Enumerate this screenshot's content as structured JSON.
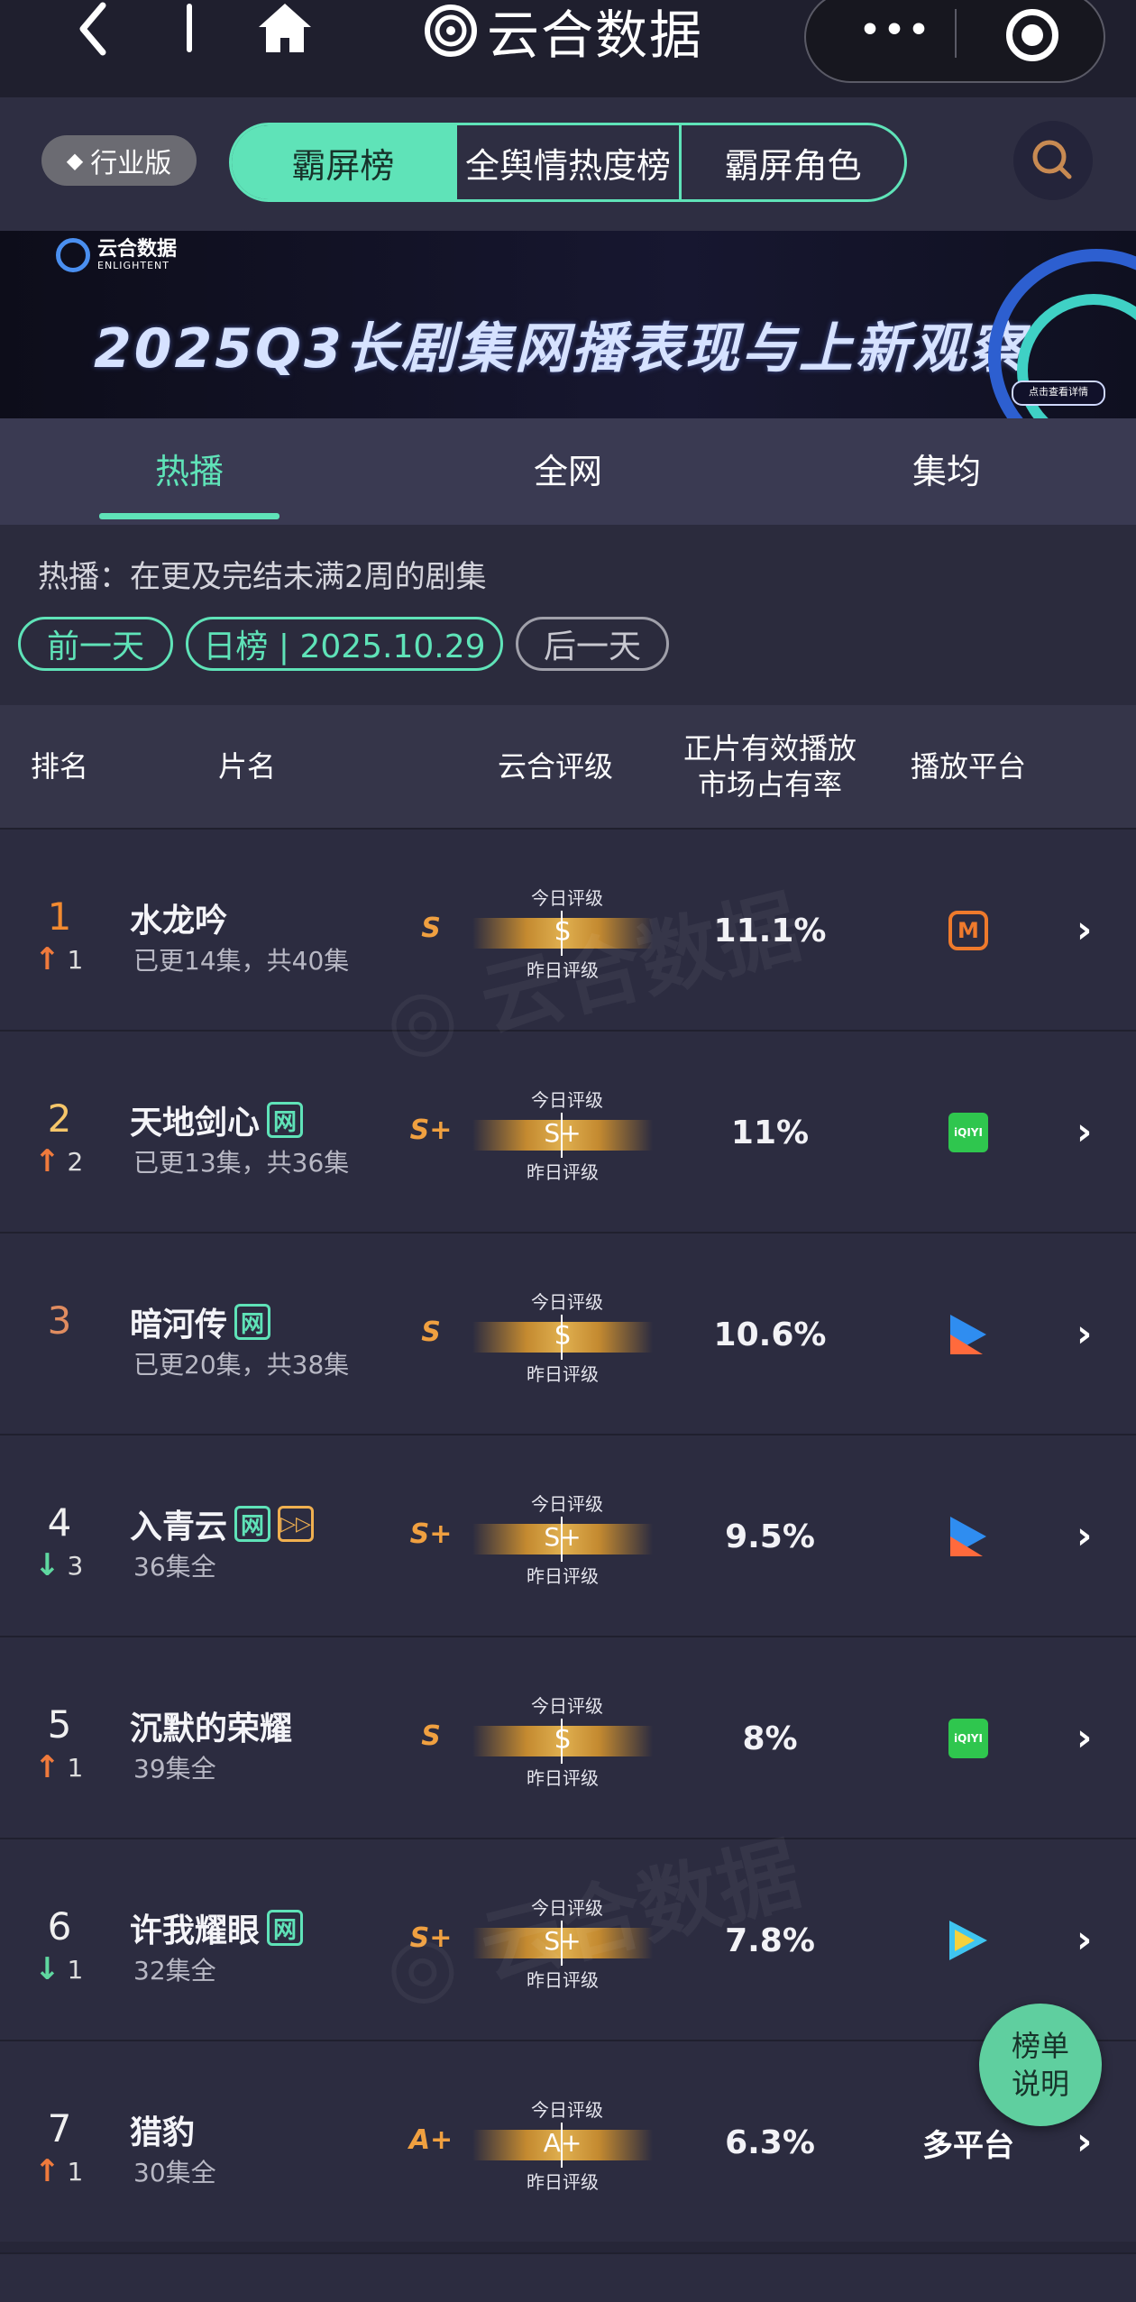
{
  "nav": {
    "title": "云合数据",
    "back_icon": "chevron-left-icon",
    "home_icon": "home-icon",
    "more_label": "•••",
    "close_icon": "target-icon"
  },
  "filters": {
    "edition_label": "行业版",
    "segments": [
      "霸屏榜",
      "全舆情热度榜",
      "霸屏角色"
    ],
    "active_segment": "霸屏榜"
  },
  "banner": {
    "logo_cn": "云合数据",
    "logo_en": "ENLIGHTENT",
    "title": "2025Q3长剧集网播表现与上新观察",
    "cta": "点击查看详情"
  },
  "tabs": [
    "热播",
    "全网",
    "集均"
  ],
  "description": "热播：在更及完结未满2周的剧集",
  "date_nav": {
    "prev": "前一天",
    "current": "日榜 | 2025.10.29",
    "next": "后一天"
  },
  "table_headers": {
    "rank": "排名",
    "title": "片名",
    "grade": "云合评级",
    "share_line1": "正片有效播放",
    "share_line2": "市场占有率",
    "platform": "播放平台"
  },
  "grade_labels": {
    "today": "今日评级",
    "yesterday": "昨日评级"
  },
  "rows": [
    {
      "rank": "1",
      "change_dir": "up",
      "change": "1",
      "name": "水龙吟",
      "tags": [],
      "episodes": "已更14集，共40集",
      "grade_yesterday": "S",
      "grade_today": "S",
      "share": "11.1%",
      "platform": "mgtv"
    },
    {
      "rank": "2",
      "change_dir": "up",
      "change": "2",
      "name": "天地剑心",
      "tags": [
        "网"
      ],
      "episodes": "已更13集，共36集",
      "grade_yesterday": "S+",
      "grade_today": "S+",
      "share": "11%",
      "platform": "iqiyi"
    },
    {
      "rank": "3",
      "change_dir": "none",
      "change": "",
      "name": "暗河传",
      "tags": [
        "网"
      ],
      "episodes": "已更20集，共38集",
      "grade_yesterday": "S",
      "grade_today": "S",
      "share": "10.6%",
      "platform": "youku"
    },
    {
      "rank": "4",
      "change_dir": "down",
      "change": "3",
      "name": "入青云",
      "tags": [
        "网",
        "vip"
      ],
      "episodes": "36集全",
      "grade_yesterday": "S+",
      "grade_today": "S+",
      "share": "9.5%",
      "platform": "youku"
    },
    {
      "rank": "5",
      "change_dir": "up",
      "change": "1",
      "name": "沉默的荣耀",
      "tags": [],
      "episodes": "39集全",
      "grade_yesterday": "S",
      "grade_today": "S",
      "share": "8%",
      "platform": "iqiyi"
    },
    {
      "rank": "6",
      "change_dir": "down",
      "change": "1",
      "name": "许我耀眼",
      "tags": [
        "网"
      ],
      "episodes": "32集全",
      "grade_yesterday": "S+",
      "grade_today": "S+",
      "share": "7.8%",
      "platform": "tencent"
    },
    {
      "rank": "7",
      "change_dir": "up",
      "change": "1",
      "name": "猎豹",
      "tags": [],
      "episodes": "30集全",
      "grade_yesterday": "A+",
      "grade_today": "A+",
      "share": "6.3%",
      "platform": "多平台"
    }
  ],
  "float_help": {
    "line1": "榜单",
    "line2": "说明"
  },
  "colors": {
    "accent": "#5fe3b8",
    "rise": "#f07a3c",
    "fall": "#5fd8a0",
    "grade": "#f0a040"
  }
}
